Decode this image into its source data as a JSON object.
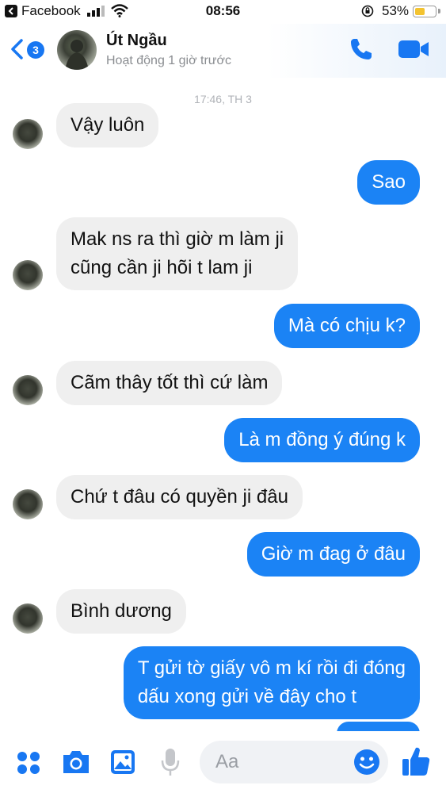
{
  "status_bar": {
    "app_name": "Facebook",
    "time": "08:56",
    "battery": "53%",
    "battery_level": 0.53
  },
  "header": {
    "badge_count": "3",
    "contact_name": "Út Ngầu",
    "activity": "Hoạt động 1 giờ trước",
    "timestamp": "17:46, TH 3"
  },
  "messages": [
    {
      "from": "them",
      "text": "Vậy luôn"
    },
    {
      "from": "me",
      "text": "Sao"
    },
    {
      "from": "them",
      "lines": [
        "Mak ns ra thì giờ m làm ji",
        "cũng cần ji hõi t lam ji"
      ]
    },
    {
      "from": "me",
      "text": "Mà có chịu k?"
    },
    {
      "from": "them",
      "text": "Cãm thây tốt thì cứ làm"
    },
    {
      "from": "me",
      "text": "Là m đồng ý đúng k"
    },
    {
      "from": "them",
      "text": "Chứ t đâu có quyền ji đâu"
    },
    {
      "from": "me",
      "text": "Giờ m đag ở đâu"
    },
    {
      "from": "them",
      "text": "Bình dương"
    },
    {
      "from": "me",
      "lines": [
        "T gửi tờ giấy vô m kí rồi đi đóng",
        "dấu xong gửi về đây cho t"
      ]
    }
  ],
  "composer": {
    "placeholder": "Aa"
  },
  "colors": {
    "accent": "#1877f2",
    "outgoing_bubble": "#1b83f5",
    "incoming_bubble": "#efefef",
    "battery": "#f3c330"
  },
  "icons": [
    "back-icon",
    "phone-icon",
    "video-icon",
    "menu-dots-icon",
    "camera-icon",
    "gallery-icon",
    "microphone-icon",
    "emoji-icon",
    "like-icon"
  ]
}
